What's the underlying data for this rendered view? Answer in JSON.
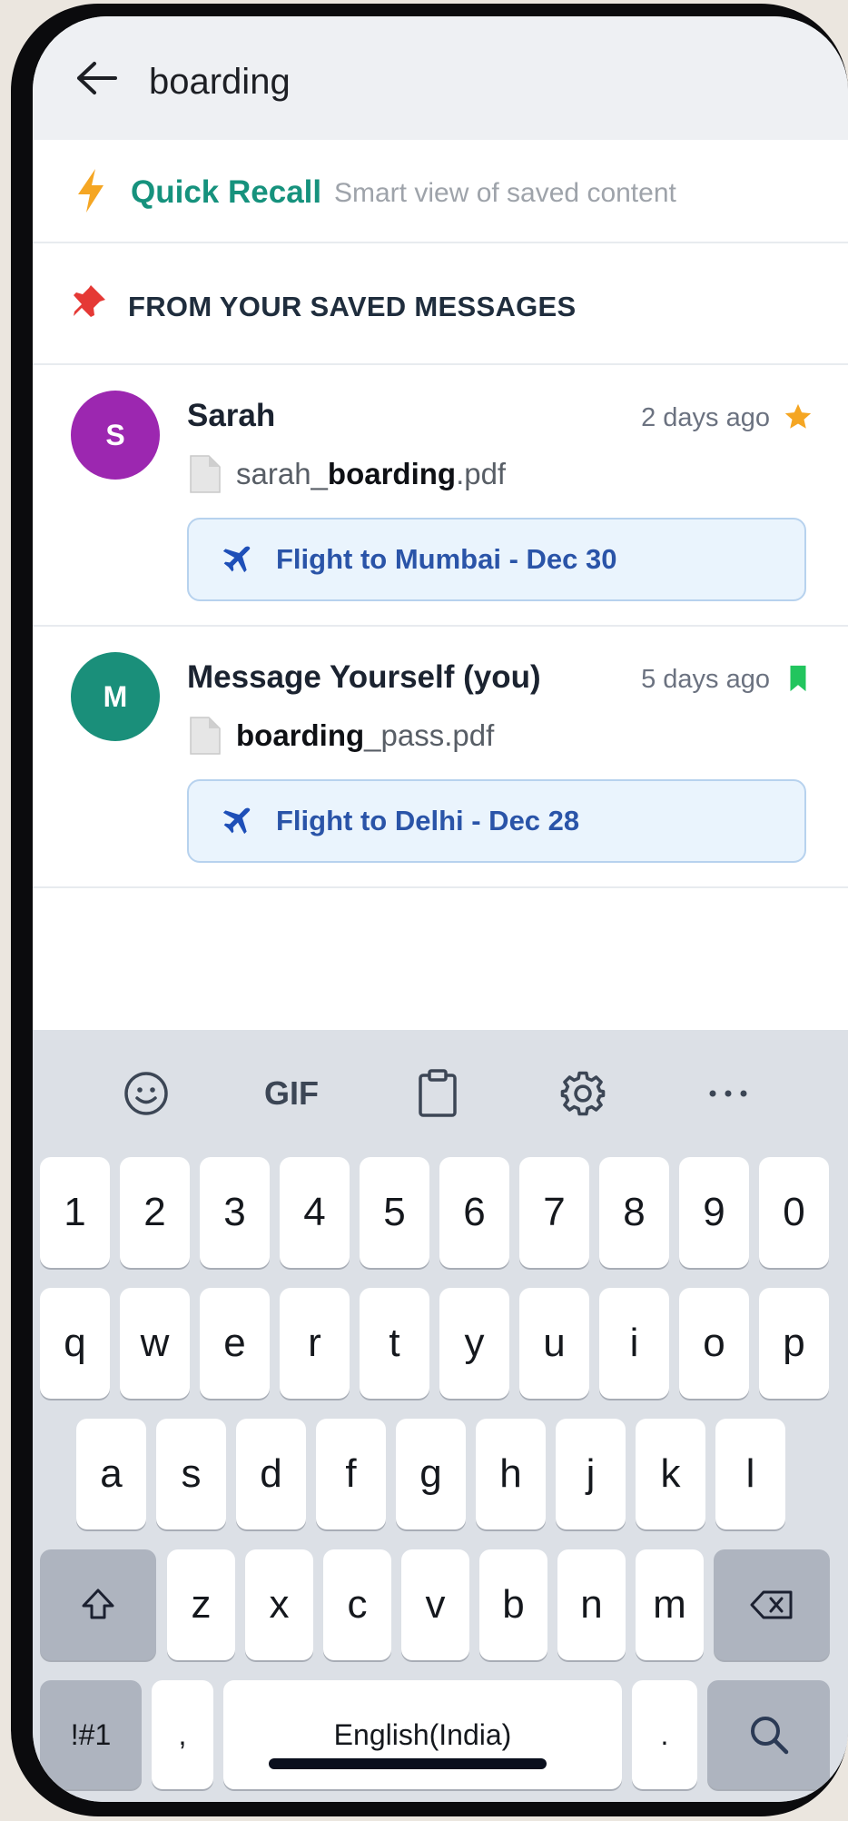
{
  "search": {
    "query": "boarding"
  },
  "quick_recall": {
    "title": "Quick Recall",
    "subtitle": "Smart view of saved content"
  },
  "saved_section": {
    "title": "FROM YOUR SAVED MESSAGES"
  },
  "messages": [
    {
      "avatar": "S",
      "avatar_color": "#9c27b0",
      "sender": "Sarah",
      "time": "2 days ago",
      "badge": "star-icon",
      "badge_color": "#f5a623",
      "file_prefix": "sarah_",
      "file_match": "boarding",
      "file_suffix": ".pdf",
      "flight": "Flight to Mumbai - Dec 30"
    },
    {
      "avatar": "M",
      "avatar_color": "#1a8f7a",
      "sender": "Message Yourself (you)",
      "time": "5 days ago",
      "badge": "bookmark-icon",
      "badge_color": "#22c55e",
      "file_prefix": "",
      "file_match": "boarding",
      "file_suffix": "_pass.pdf",
      "flight": "Flight to Delhi - Dec 28"
    }
  ],
  "keyboard": {
    "toolbar": {
      "gif": "GIF"
    },
    "row_numbers": [
      "1",
      "2",
      "3",
      "4",
      "5",
      "6",
      "7",
      "8",
      "9",
      "0"
    ],
    "row1": [
      "q",
      "w",
      "e",
      "r",
      "t",
      "y",
      "u",
      "i",
      "o",
      "p"
    ],
    "row2": [
      "a",
      "s",
      "d",
      "f",
      "g",
      "h",
      "j",
      "k",
      "l"
    ],
    "row3": [
      "z",
      "x",
      "c",
      "v",
      "b",
      "n",
      "m"
    ],
    "symbols": "!#1",
    "comma": ",",
    "space": "English(India)",
    "period": "."
  },
  "colors": {
    "accent": "#16927d",
    "flight_text": "#2a54a8"
  }
}
